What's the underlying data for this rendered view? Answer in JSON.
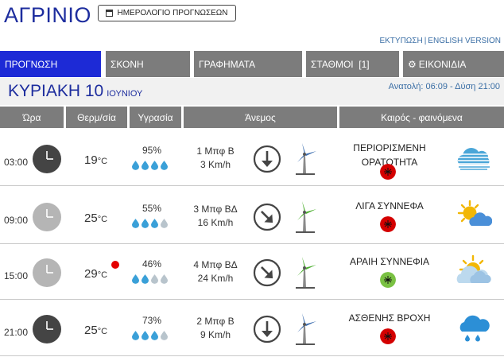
{
  "header": {
    "city": "ΑΓΡΙΝΙΟ",
    "calendar_button": "ΗΜΕΡΟΛΟΓΙΟ ΠΡΟΓΝΩΣΕΩΝ",
    "print_link": "ΕΚΤΥΠΩΣΗ",
    "separator": "|",
    "english_link": "ENGLISH VERSION"
  },
  "tabs": [
    {
      "label": "ΠΡΟΓΝΩΣΗ",
      "active": true
    },
    {
      "label": "ΣΚΟΝΗ",
      "active": false
    },
    {
      "label": "ΓΡΑΦΗΜΑΤΑ",
      "active": false
    },
    {
      "label": "ΣΤΑΘΜΟΙ  [1]",
      "active": false
    },
    {
      "label": "ΕΙΚΟΝΙΔΙΑ",
      "active": false,
      "icon": "gear-icon"
    }
  ],
  "day": {
    "title": "ΚΥΡΙΑΚΗ 10",
    "month": "ΙΟΥΝΙΟΥ",
    "sun_times": "Ανατολή: 06:09 - Δύση 21:00"
  },
  "columns": {
    "hour": "Ώρα",
    "temp": "Θερμ/σία",
    "humidity": "Υγρασία",
    "wind": "Άνεμος",
    "weather": "Καιρός - φαινόμενα"
  },
  "rows": [
    {
      "time": "03:00",
      "clock": "dark-clock-icon",
      "temp": "19",
      "unit": "°C",
      "hot": false,
      "humidity": "95%",
      "drops_filled": 4,
      "wind_force": "1 Μπφ Β",
      "wind_speed": "3 Km/h",
      "wind_dir": "N",
      "weather_line1": "ΠΕΡΙΟΡΙΣΜΕΝΗ",
      "weather_line2": "ΟΡΑΤΟΤΗΤΑ",
      "badge": "mosquito-red-icon",
      "icon": "fog-icon"
    },
    {
      "time": "09:00",
      "clock": "light-clock-icon",
      "temp": "25",
      "unit": "°C",
      "hot": false,
      "humidity": "55%",
      "drops_filled": 3,
      "wind_force": "3 Μπφ ΒΔ",
      "wind_speed": "16 Km/h",
      "wind_dir": "NW",
      "weather_line1": "ΛΙΓΑ ΣΥΝΝΕΦΑ",
      "weather_line2": "",
      "badge": "mosquito-red-icon",
      "icon": "sun-cloud-icon"
    },
    {
      "time": "15:00",
      "clock": "light-clock-icon",
      "temp": "29",
      "unit": "°C",
      "hot": true,
      "humidity": "46%",
      "drops_filled": 2,
      "wind_force": "4 Μπφ ΒΔ",
      "wind_speed": "24 Km/h",
      "wind_dir": "NW",
      "weather_line1": "ΑΡΑΙΗ ΣΥΝΝΕΦΙΑ",
      "weather_line2": "",
      "badge": "mosquito-green-icon",
      "icon": "sun-behind-cloud-icon"
    },
    {
      "time": "21:00",
      "clock": "dark-clock-icon",
      "temp": "25",
      "unit": "°C",
      "hot": false,
      "humidity": "73%",
      "drops_filled": 3,
      "wind_force": "2 Μπφ Β",
      "wind_speed": "9 Km/h",
      "wind_dir": "N",
      "weather_line1": "ΑΣΘΕΝΗΣ ΒΡΟΧΗ",
      "weather_line2": "",
      "badge": "mosquito-red-icon",
      "icon": "rain-cloud-icon"
    }
  ],
  "colors": {
    "accent": "#1d2ad6",
    "title": "#1d2d9e",
    "tab": "#7c7c7c",
    "drop_filled": "#3aa0d8",
    "drop_empty": "#b8c4cc",
    "badge_red": "#d40000",
    "badge_green": "#7ac143"
  }
}
